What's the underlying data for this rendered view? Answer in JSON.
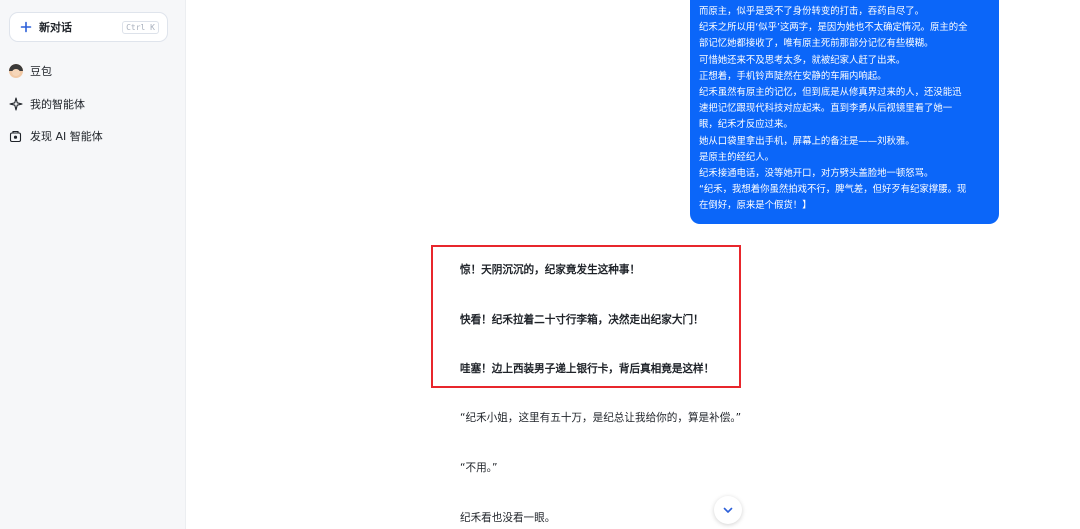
{
  "sidebar": {
    "new_chat": {
      "label": "新对话",
      "shortcut": "Ctrl K"
    },
    "items": [
      {
        "label": "豆包",
        "icon": "doubao-avatar-icon"
      },
      {
        "label": "我的智能体",
        "icon": "sparkle-icon"
      },
      {
        "label": "发现 AI 智能体",
        "icon": "discover-icon"
      }
    ]
  },
  "conversation": {
    "user_message_lines": [
      "而原主，似乎是受不了身份转变的打击，吞药自尽了。",
      "纪禾之所以用‘似乎’这两字，是因为她也不太确定情况。原主的全",
      "部记忆她都接收了，唯有原主死前那部分记忆有些模糊。",
      "可惜她还来不及思考太多，就被纪家人赶了出来。",
      "正想着，手机铃声陡然在安静的车厢内响起。",
      "纪禾虽然有原主的记忆，但到底是从修真界过来的人，还没能迅",
      "速把记忆跟现代科技对应起来。直到李勇从后视镜里看了她一",
      "眼，纪禾才反应过来。",
      "她从口袋里拿出手机，屏幕上的备注是——刘秋雅。",
      "是原主的经纪人。",
      "纪禾接通电话，没等她开口，对方劈头盖脸地一顿怒骂。",
      "“纪禾，我想着你虽然拍戏不行，脾气差，但好歹有纪家撑腰。现",
      "在倒好，原来是个假货！】"
    ],
    "assistant_headlines": [
      "惊！天阴沉沉的，纪家竟发生这种事！",
      "快看！纪禾拉着二十寸行李箱，决然走出纪家大门！",
      "哇塞！边上西装男子递上银行卡，背后真相竟是这样！"
    ],
    "assistant_paragraphs": [
      "“纪禾小姐，这里有五十万，是纪总让我给你的，算是补偿。”",
      "“不用。”",
      "纪禾看也没看一眼。"
    ]
  },
  "colors": {
    "user_bubble": "#0b66f9",
    "highlight_border": "#e8262c",
    "sidebar_bg": "#f6f7f9"
  },
  "icons": {
    "plus": "plus-icon",
    "scroll_down": "chevron-down-icon"
  }
}
